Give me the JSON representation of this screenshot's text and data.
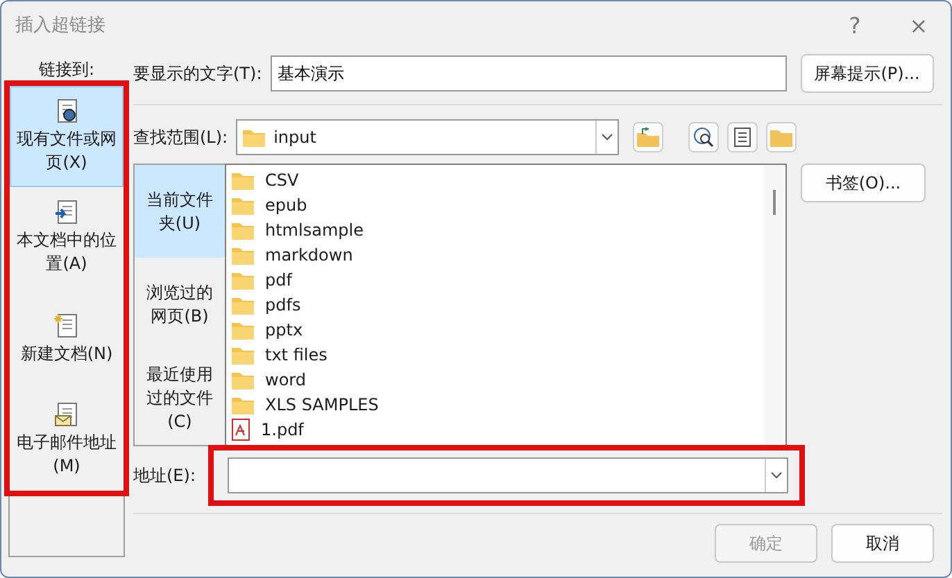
{
  "window": {
    "title": "插入超链接",
    "help": "?",
    "close": "×"
  },
  "link_to": {
    "label": "链接到:",
    "highlighted": true,
    "items": [
      {
        "label": "现有文件或网页(X)",
        "kind": "file",
        "selected": true
      },
      {
        "label": "本文档中的位置(A)",
        "kind": "place",
        "selected": false
      },
      {
        "label": "新建文档(N)",
        "kind": "new",
        "selected": false
      },
      {
        "label": "电子邮件地址(M)",
        "kind": "email",
        "selected": false
      }
    ]
  },
  "display_text": {
    "label": "要显示的文字(T):",
    "value": "基本演示"
  },
  "screen_tip_button": "屏幕提示(P)...",
  "look_in": {
    "label": "查找范围(L):",
    "value": "input"
  },
  "nav": [
    {
      "label": "当前文件夹(U)",
      "selected": true
    },
    {
      "label": "浏览过的网页(B)",
      "selected": false
    },
    {
      "label": "最近使用过的文件(C)",
      "selected": false
    }
  ],
  "files": [
    {
      "name": "CSV",
      "kind": "folder"
    },
    {
      "name": "epub",
      "kind": "folder"
    },
    {
      "name": "htmlsample",
      "kind": "folder"
    },
    {
      "name": "markdown",
      "kind": "folder"
    },
    {
      "name": "pdf",
      "kind": "folder"
    },
    {
      "name": "pdfs",
      "kind": "folder"
    },
    {
      "name": "pptx",
      "kind": "folder"
    },
    {
      "name": "txt files",
      "kind": "folder"
    },
    {
      "name": "word",
      "kind": "folder"
    },
    {
      "name": "XLS SAMPLES",
      "kind": "folder"
    },
    {
      "name": "1.pdf",
      "kind": "pdf"
    }
  ],
  "bookmark_button": "书签(O)...",
  "address": {
    "label": "地址(E):",
    "highlighted": true
  },
  "buttons": [
    {
      "label": "确定",
      "disabled": true
    },
    {
      "label": "取消",
      "disabled": false
    }
  ]
}
